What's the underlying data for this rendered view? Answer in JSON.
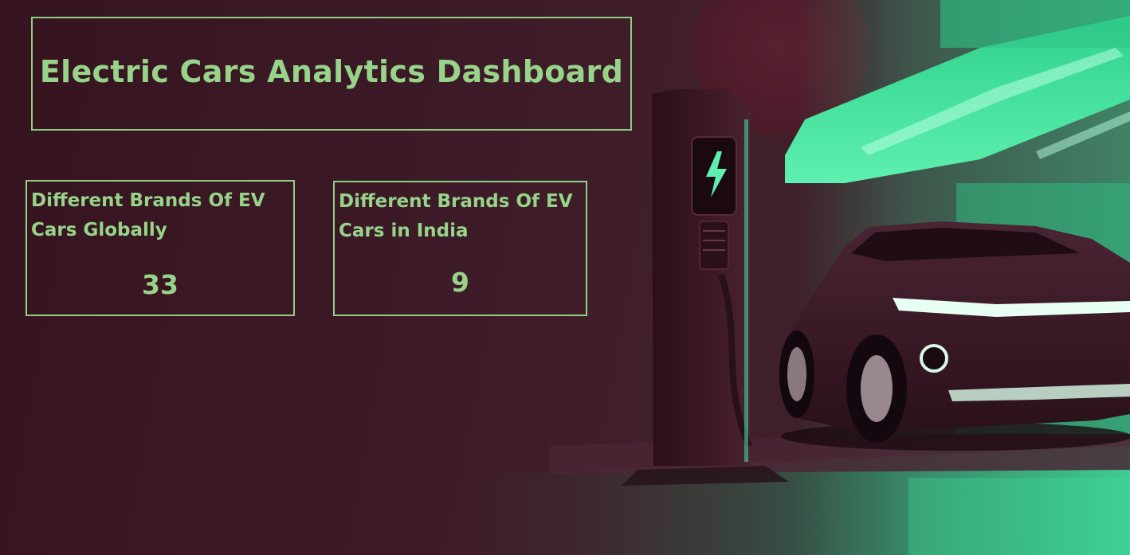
{
  "dashboard": {
    "title": "Electric Cars Analytics Dashboard"
  },
  "kpis": [
    {
      "label": "Different Brands Of EV Cars Globally",
      "value": "33"
    },
    {
      "label": "Different Brands Of EV Cars in India",
      "value": "9"
    }
  ],
  "colors": {
    "accent": "#97d48a",
    "background": "#3a1824",
    "hero_green": "#3fd99a",
    "car_body": "#3a1c28"
  },
  "icons": {
    "charger_symbol": "lightning-bolt-icon"
  }
}
